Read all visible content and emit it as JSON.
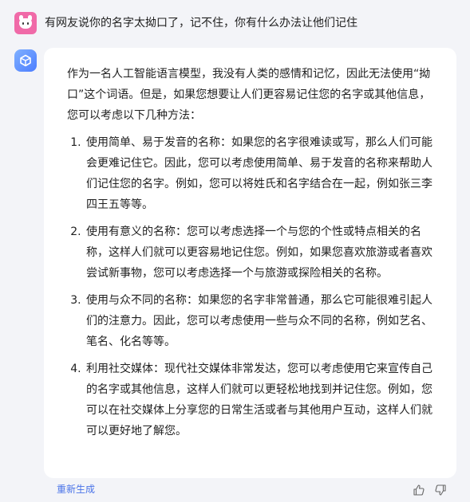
{
  "user": {
    "question": "有网友说你的名字太拗口了，记不住，你有什么办法让他们记住"
  },
  "answer": {
    "intro": "作为一名人工智能语言模型，我没有人类的感情和记忆，因此无法使用“拗口”这个词语。但是，如果您想要让人们更容易记住您的名字或其他信息，您可以考虑以下几种方法：",
    "tips": [
      {
        "text": "使用简单、易于发音的名称：如果您的名字很难读或写，那么人们可能会更难记住它。因此，您可以考虑使用简单、易于发音的名称来帮助人们记住您的名字。例如，您可以将姓氏和名字结合在一起，例如张三李四王五等等。"
      },
      {
        "text": "使用有意义的名称：您可以考虑选择一个与您的个性或特点相关的名称，这样人们就可以更容易地记住您。例如，如果您喜欢旅游或者喜欢尝试新事物，您可以考虑选择一个与旅游或探险相关的名称。"
      },
      {
        "text": "使用与众不同的名称：如果您的名字非常普通，那么它可能很难引起人们的注意力。因此，您可以考虑使用一些与众不同的名称，例如艺名、笔名、化名等等。"
      },
      {
        "text": "利用社交媒体：现代社交媒体非常发达，您可以考虑使用它来宣传自己的名字或其他信息，这样人们就可以更轻松地找到并记住您。例如，您可以在社交媒体上分享您的日常生活或者与其他用户互动，这样人们就可以更好地了解您。"
      }
    ]
  },
  "footer": {
    "regenerate_label": "重新生成"
  },
  "icons": {
    "user_avatar": "pig-avatar-icon",
    "bot_avatar": "cube-logo-icon",
    "like": "thumbs-up-icon",
    "dislike": "thumbs-down-icon"
  },
  "colors": {
    "accent": "#4a73e8",
    "background": "#f3f4f8",
    "card": "#ffffff",
    "user_avatar": "#f06aa8"
  }
}
